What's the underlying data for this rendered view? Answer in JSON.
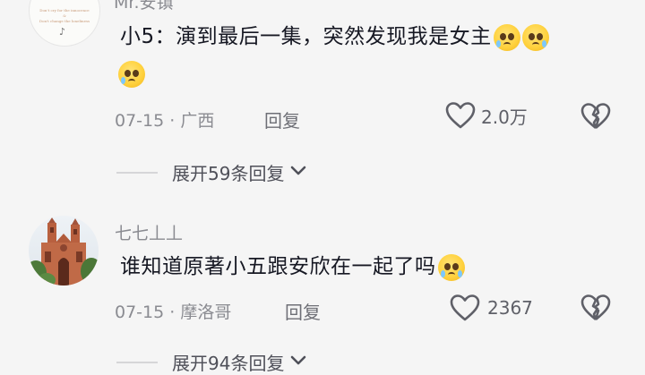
{
  "comments": [
    {
      "username": "Mr.安镇",
      "text_line1": "小5：演到最后一集，突然发现我是女主",
      "date": "07-15",
      "location": "广西",
      "reply_label": "回复",
      "like_count": "2.0万",
      "expand_label": "展开59条回复",
      "avatar_text_lines": [
        "Don't cry for the innocence",
        "&",
        "Don't change the loneliness"
      ]
    },
    {
      "username": "七七丄丄",
      "text": "谁知道原著小五跟安欣在一起了吗",
      "date": "07-15",
      "location": "摩洛哥",
      "reply_label": "回复",
      "like_count": "2367",
      "expand_label": "展开94条回复"
    }
  ],
  "icons": [
    "heart-outline-icon",
    "broken-heart-icon",
    "chevron-down-icon",
    "crying-face-emoji",
    "tiktok-logo-icon"
  ],
  "colors": {
    "background": "#f5f5f5",
    "text": "#161823",
    "muted": "#8a8b91",
    "emoji": "#ffd23f"
  }
}
